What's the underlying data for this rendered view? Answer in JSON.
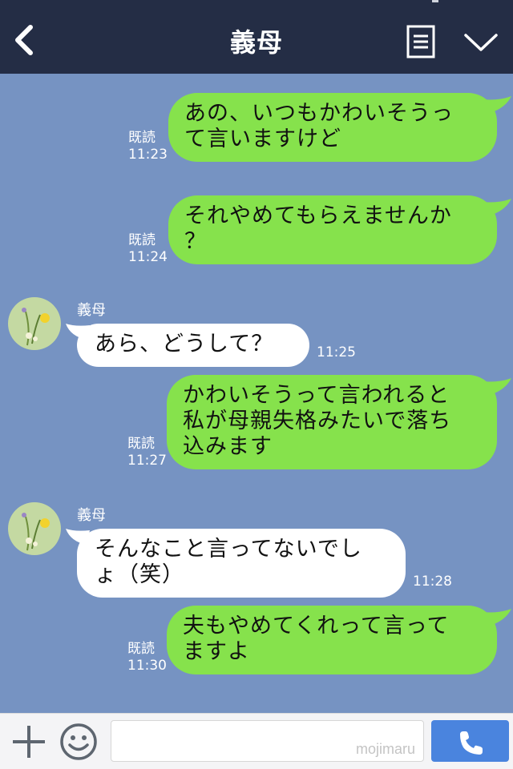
{
  "header": {
    "title": "義母",
    "back_icon": "chevron-left-icon",
    "menu_icon": "notes-icon",
    "expand_icon": "chevron-down-icon"
  },
  "messages": [
    {
      "direction": "out",
      "lines": [
        "あの、いつもかわいそうっ",
        "て言いますけど"
      ],
      "read": "既読",
      "time": "11:23"
    },
    {
      "direction": "out",
      "lines": [
        "それやめてもらえませんか",
        "？"
      ],
      "read": "既読",
      "time": "11:24"
    },
    {
      "direction": "in",
      "sender": "義母",
      "lines": [
        "あら、どうして？"
      ],
      "time": "11:25"
    },
    {
      "direction": "out",
      "lines": [
        "かわいそうって言われると",
        "私が母親失格みたいで落ち",
        "込みます"
      ],
      "read": "既読",
      "time": "11:27"
    },
    {
      "direction": "in",
      "sender": "義母",
      "lines": [
        "そんなこと言ってないでし",
        "ょ（笑）"
      ],
      "time": "11:28"
    },
    {
      "direction": "out",
      "lines": [
        "夫もやめてくれって言って",
        "ますよ"
      ],
      "read": "既読",
      "time": "11:30"
    }
  ],
  "footer": {
    "plus_icon": "plus-icon",
    "sticker_icon": "smiley-icon",
    "input_value": "",
    "watermark": "mojimaru",
    "send_icon": "phone-icon"
  },
  "colors": {
    "header_bg": "#242d45",
    "chat_bg": "#7693c2",
    "outgoing_bubble": "#86e24c",
    "incoming_bubble": "#ffffff",
    "send_button": "#4a84de"
  }
}
